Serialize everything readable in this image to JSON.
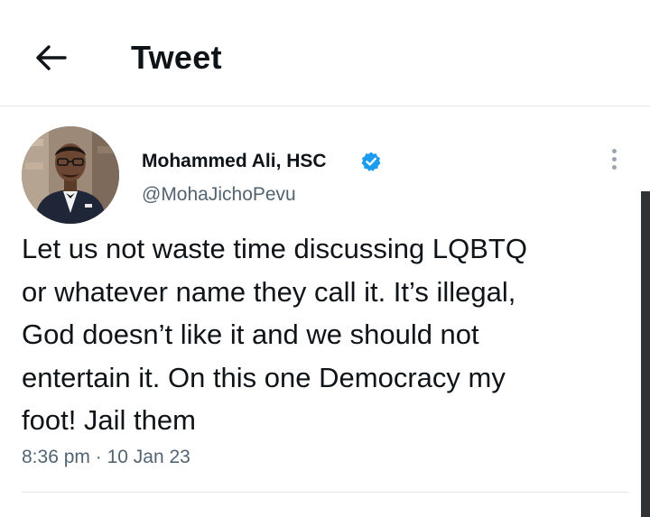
{
  "header": {
    "title": "Tweet",
    "back_icon": "arrow-left-icon"
  },
  "tweet": {
    "author": {
      "name": "Mohammed Ali, HSC",
      "handle": "@MohaJichoPevu",
      "verified_icon": "verified-badge-icon",
      "verified_color": "#1d9bf0"
    },
    "text_lines": [
      "Let us not waste time discussing LQBTQ",
      "or whatever name they call it. It’s illegal,",
      "God doesn’t like it and we should not",
      "entertain it. On this one Democracy my",
      "foot! Jail them"
    ],
    "time": "8:36 pm",
    "separator": "·",
    "date": "10 Jan 23",
    "more_icon": "more-vertical-icon"
  }
}
